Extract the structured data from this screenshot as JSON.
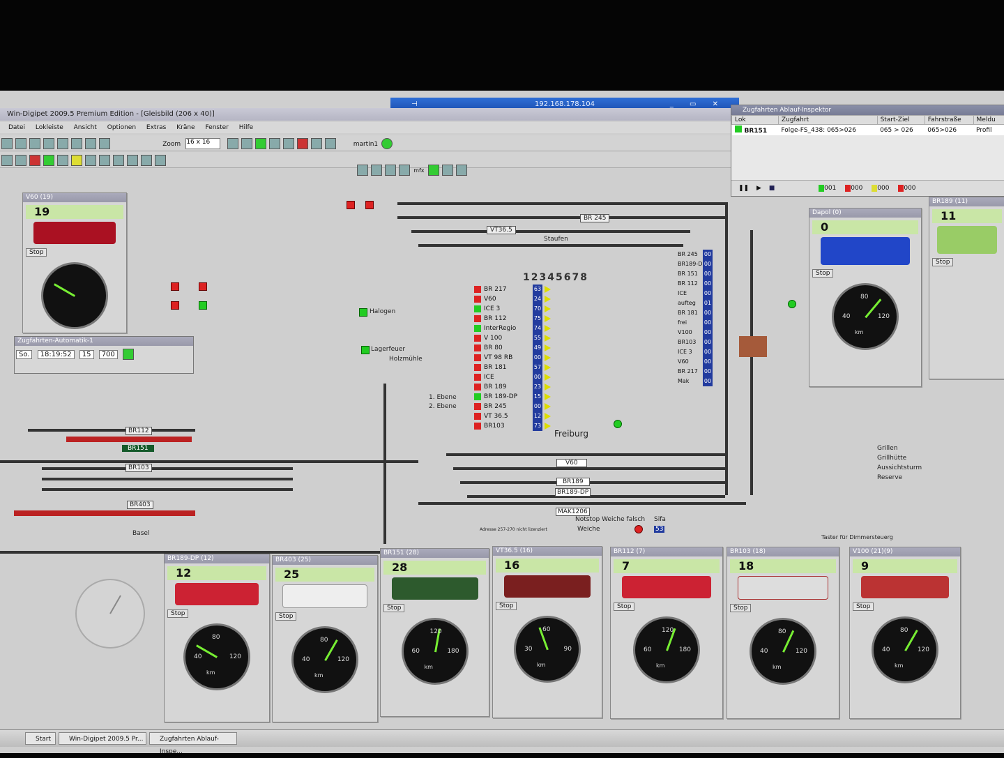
{
  "rdp": {
    "host": "192.168.178.104"
  },
  "window": {
    "title": "Win-Digipet 2009.5 Premium Edition - [Gleisbild (206 x 40)]"
  },
  "menu": [
    "Datei",
    "Lokleiste",
    "Ansicht",
    "Optionen",
    "Extras",
    "Kräne",
    "Fenster",
    "Hilfe"
  ],
  "toolbar": {
    "zoom_label": "Zoom",
    "zoom_value": "16 x 16",
    "user": "martin1",
    "mfx": "mfx"
  },
  "inspector": {
    "title": "Zugfahrten Ablauf-Inspektor",
    "columns": [
      "Lok",
      "Zugfahrt",
      "Start-Ziel",
      "Fahrstraße",
      "Meldu"
    ],
    "row": {
      "lok": "BR151",
      "zugfahrt": "Folge-FS_438: 065>026",
      "start_ziel": "065 > 026",
      "fahrstrasse": "065>026",
      "meldung": "Profil"
    },
    "counters": [
      "001",
      "000",
      "000",
      "000"
    ]
  },
  "automatic": {
    "title": "Zugfahrten-Automatik-1",
    "day": "So.",
    "time": "18:19:52",
    "v1": "15",
    "v2": "700"
  },
  "stations": {
    "staufen": "Staufen",
    "freiburg": "Freiburg",
    "basel": "Basel",
    "holzmuehle": "Holzmühle",
    "halogen": "Halogen",
    "lagerfeuer": "Lagerfeuer"
  },
  "numbers_row": "12345678",
  "route_list": [
    {
      "name": "BR 217",
      "num": "63",
      "green": false
    },
    {
      "name": "V60",
      "num": "24",
      "green": false
    },
    {
      "name": "ICE 3",
      "num": "70",
      "green": true
    },
    {
      "name": "BR 112",
      "num": "75",
      "green": false
    },
    {
      "name": "InterRegio",
      "num": "74",
      "green": true
    },
    {
      "name": "V 100",
      "num": "55",
      "green": false
    },
    {
      "name": "BR 80",
      "num": "49",
      "green": false
    },
    {
      "name": "VT 98 RB",
      "num": "00",
      "green": false
    },
    {
      "name": "BR 181",
      "num": "57",
      "green": false
    },
    {
      "name": "ICE",
      "num": "00",
      "green": false
    },
    {
      "name": "BR 189",
      "num": "23",
      "green": false
    },
    {
      "name": "BR 189-DP",
      "num": "15",
      "green": true
    },
    {
      "name": "BR 245",
      "num": "00",
      "green": false
    },
    {
      "name": "VT 36.5",
      "num": "12",
      "green": false
    },
    {
      "name": "BR103",
      "num": "73",
      "green": false
    }
  ],
  "right_list": [
    {
      "name": "BR 245",
      "num": "00"
    },
    {
      "name": "BR189-D",
      "num": "00"
    },
    {
      "name": "BR 151",
      "num": "00"
    },
    {
      "name": "BR 112",
      "num": "00"
    },
    {
      "name": "ICE",
      "num": "00"
    },
    {
      "name": "aufteg",
      "num": "01"
    },
    {
      "name": "BR 181",
      "num": "00"
    },
    {
      "name": "frei",
      "num": "00"
    },
    {
      "name": "V100",
      "num": "00"
    },
    {
      "name": "BR103",
      "num": "00"
    },
    {
      "name": "ICE 3",
      "num": "00"
    },
    {
      "name": "V60",
      "num": "00"
    },
    {
      "name": "BR 217",
      "num": "00"
    },
    {
      "name": "Mak",
      "num": "00"
    }
  ],
  "track_labels": [
    "BR112",
    "BR151",
    "BR103",
    "BR403",
    "V60",
    "BR189",
    "BR189-DP",
    "MAK1206",
    "BR 245",
    "VT36.5"
  ],
  "legend": {
    "notstop": "Notstop Weiche falsch",
    "sifa": "Sifa",
    "weiche": "Weiche",
    "counter": "53",
    "adresse": "Adresse 257-270 nicht lizenziert",
    "tafel": "Taster für Dimmersteuerg"
  },
  "extra_buttons": [
    "1. Ebene",
    "2. Ebene",
    "Grillen",
    "Grillhütte",
    "Aussichtsturm",
    "Reserve"
  ],
  "stop_label": "Stop",
  "gauge_unit": "km",
  "loco_panels_top": [
    {
      "name": "V60",
      "addr": "(19)",
      "speed": "19"
    },
    {
      "name": "Dapol",
      "addr": "(0)",
      "speed": "0"
    },
    {
      "name": "BR189",
      "addr": "(11)",
      "speed": "11"
    }
  ],
  "loco_panels_bottom": [
    {
      "name": "BR189-DP",
      "addr": "(12)",
      "speed": "12",
      "color": "#c23"
    },
    {
      "name": "BR403",
      "addr": "(25)",
      "speed": "25",
      "color": "#eee"
    },
    {
      "name": "BR151",
      "addr": "(28)",
      "speed": "28",
      "color": "#2d5a2d"
    },
    {
      "name": "VT36.5",
      "addr": "(16)",
      "speed": "16",
      "color": "#7a1f1f"
    },
    {
      "name": "BR112",
      "addr": "(7)",
      "speed": "7",
      "color": "#c23"
    },
    {
      "name": "BR103",
      "addr": "(18)",
      "speed": "18",
      "color": "#ddd"
    },
    {
      "name": "V100",
      "addr": "(21)(9)",
      "speed": "9",
      "color": "#b33"
    }
  ],
  "gauges": [
    {
      "lo": "40",
      "mid": "80",
      "hi": "120",
      "max": "160",
      "angle": -60
    },
    {
      "lo": "40",
      "mid": "80",
      "hi": "120",
      "max": "160",
      "angle": 30
    },
    {
      "lo": "60",
      "mid": "120",
      "hi": "180",
      "max": "240",
      "angle": 10
    },
    {
      "lo": "30",
      "mid": "60",
      "hi": "90",
      "max": "120",
      "angle": -20
    },
    {
      "lo": "60",
      "mid": "120",
      "hi": "180",
      "max": "240",
      "angle": 20
    },
    {
      "lo": "40",
      "mid": "80",
      "hi": "120",
      "max": "160",
      "angle": 25
    },
    {
      "lo": "40",
      "mid": "80",
      "hi": "120",
      "max": "160",
      "angle": 30
    }
  ],
  "taskbar": {
    "start": "Start",
    "item1": "Win-Digipet 2009.5 Pr...",
    "item2": "Zugfahrten Ablauf-Inspe..."
  }
}
